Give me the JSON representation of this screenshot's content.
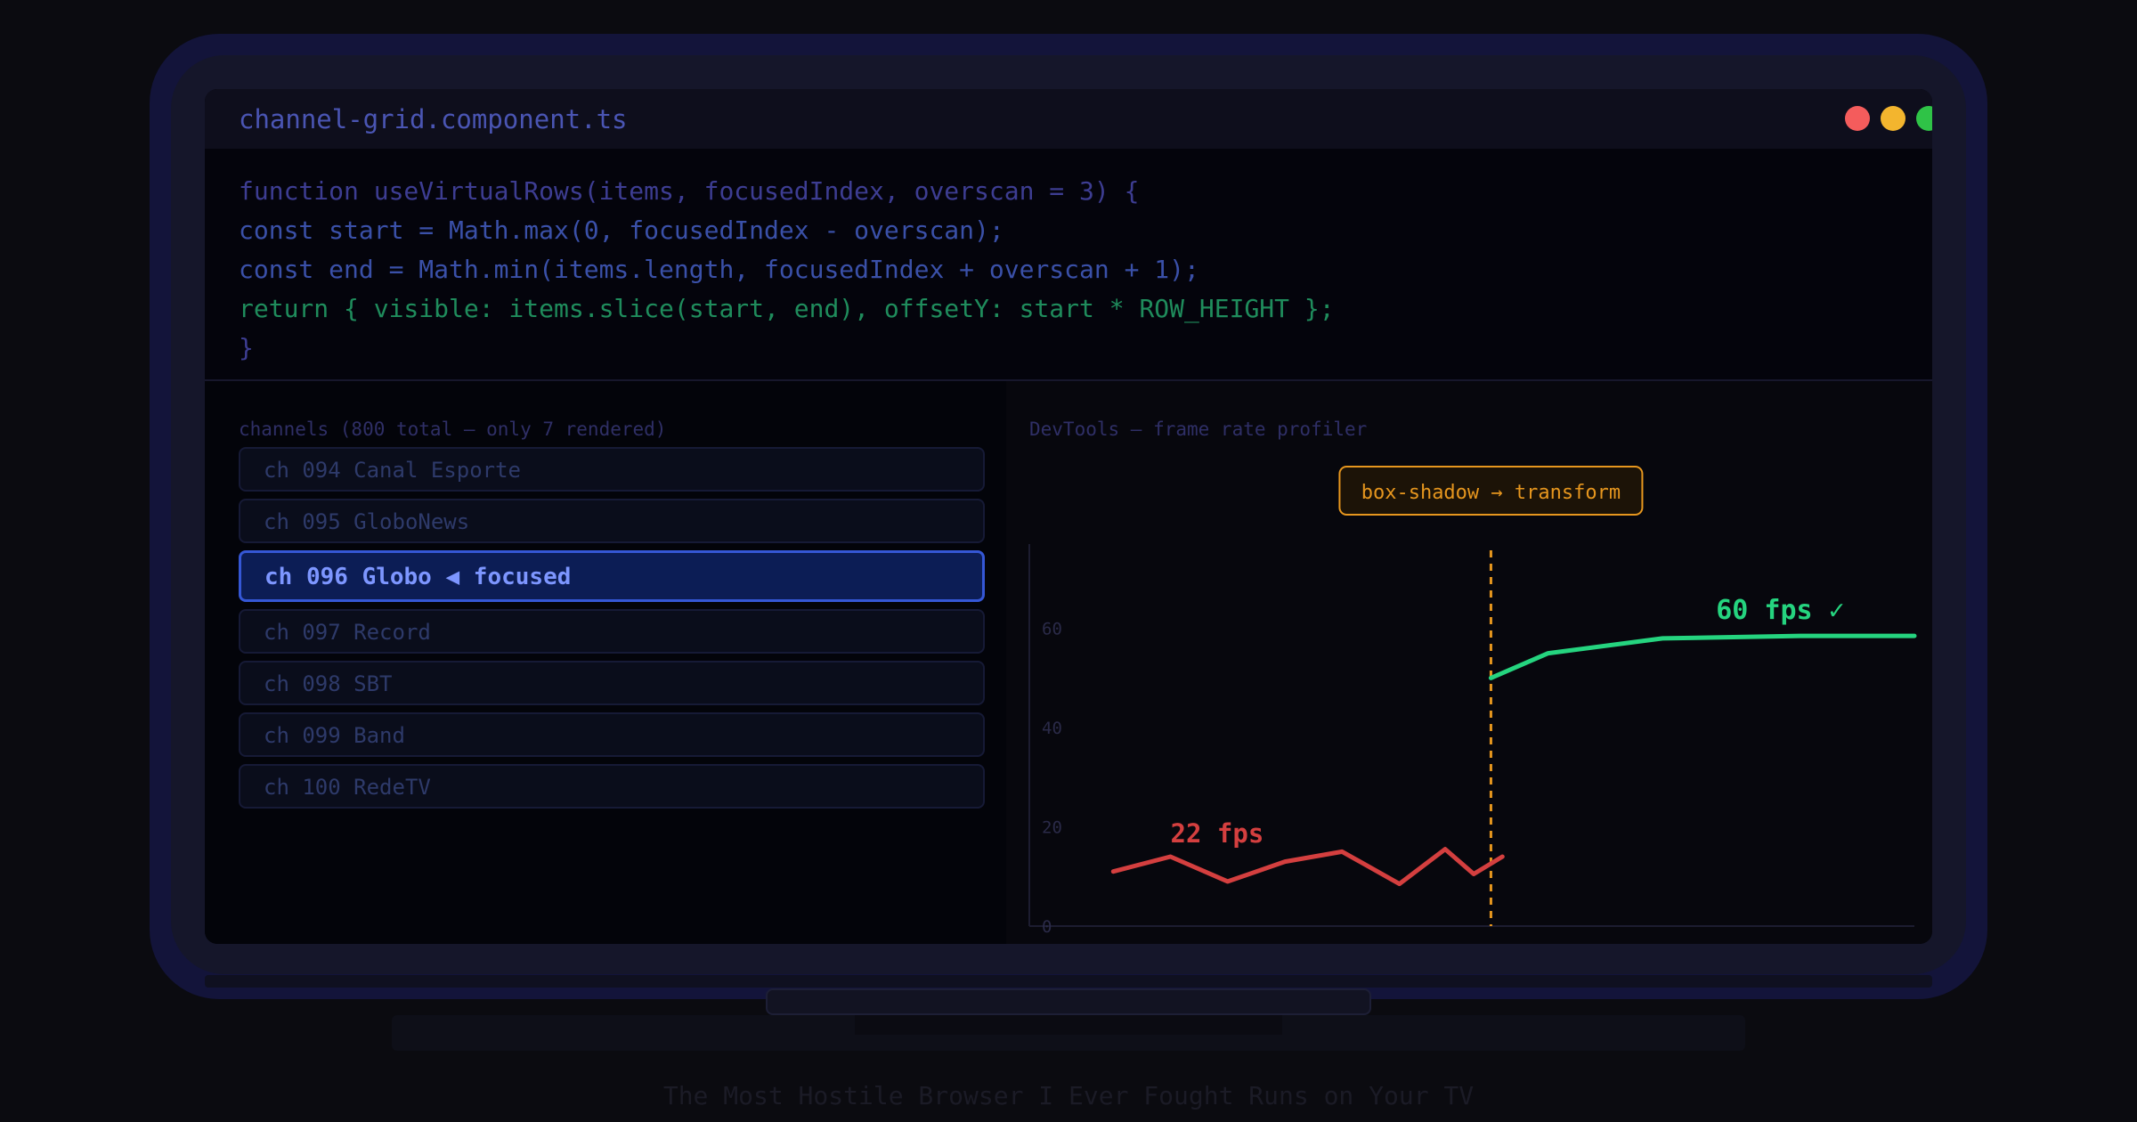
{
  "editor": {
    "filename": "channel-grid.component.ts",
    "code_lines": [
      {
        "text": "function useVirtualRows(items, focusedIndex, overscan = 3) {",
        "color": "#3d3d92"
      },
      {
        "text": "const start = Math.max(0, focusedIndex - overscan);",
        "color": "#3a50a8"
      },
      {
        "text": "const end = Math.min(items.length, focusedIndex + overscan + 1);",
        "color": "#3a50a8"
      },
      {
        "text": "return { visible: items.slice(start, end), offsetY: start * ROW_HEIGHT };",
        "color": "#1f8c5c"
      },
      {
        "text": "}",
        "color": "#3d3d92"
      }
    ],
    "window_controls": [
      "close-dot",
      "minimize-dot",
      "maximize-dot"
    ]
  },
  "channels": {
    "caption": "channels (800 total — only 7 rendered)",
    "rows": [
      {
        "label": "ch 094 Canal Esporte",
        "focused": false
      },
      {
        "label": "ch 095 GloboNews",
        "focused": false
      },
      {
        "label": "ch 096 Globo ◀ focused",
        "focused": true
      },
      {
        "label": "ch 097 Record",
        "focused": false
      },
      {
        "label": "ch 098 SBT",
        "focused": false
      },
      {
        "label": "ch 099 Band",
        "focused": false
      },
      {
        "label": "ch 100 RedeTV",
        "focused": false
      }
    ]
  },
  "profiler": {
    "caption": "DevTools — frame rate profiler"
  },
  "chart_data": {
    "type": "line",
    "yticks": [
      0,
      20,
      40,
      60
    ],
    "ylim": [
      0,
      77
    ],
    "xlim": [
      0,
      15
    ],
    "grid": false,
    "series": [
      {
        "name": "22 fps",
        "color": "#d43f3f",
        "points": [
          [
            1,
            11
          ],
          [
            2,
            14
          ],
          [
            3,
            9
          ],
          [
            4,
            13
          ],
          [
            5,
            15
          ],
          [
            6,
            8.5
          ],
          [
            6.8,
            15.5
          ],
          [
            7.3,
            10.5
          ],
          [
            7.8,
            14
          ]
        ]
      },
      {
        "name": "60 fps ✓",
        "color": "#25d47f",
        "points": [
          [
            7.6,
            50
          ],
          [
            8.6,
            55
          ],
          [
            10.6,
            58
          ],
          [
            13,
            58.5
          ],
          [
            15,
            58.5
          ]
        ]
      }
    ],
    "annotation": {
      "label": "box-shadow → transform",
      "x": 7.6,
      "color": "#e6961e"
    }
  },
  "footer": {
    "caption": "The Most Hostile Browser I Ever Fought Runs on Your TV"
  }
}
